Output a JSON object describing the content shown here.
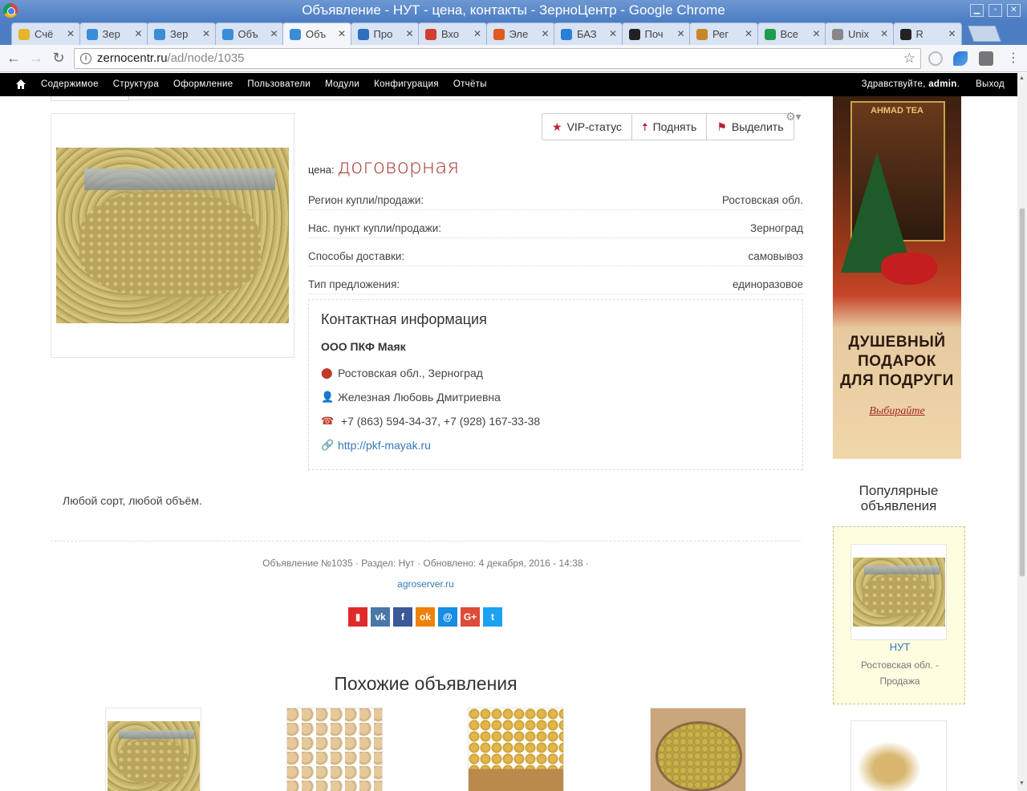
{
  "window": {
    "title": "Объявление - НУТ - цена, контакты - ЗерноЦентр - Google Chrome"
  },
  "tabs": [
    {
      "label": "Счё",
      "color": "#e8b52a"
    },
    {
      "label": "Зер",
      "color": "#3a8ed8"
    },
    {
      "label": "Зер",
      "color": "#3a8ed8"
    },
    {
      "label": "Объ",
      "color": "#3a8ed8"
    },
    {
      "label": "Объ",
      "color": "#3a8ed8"
    },
    {
      "label": "Про",
      "color": "#2f6fbf"
    },
    {
      "label": "Вхо",
      "color": "#d23f31"
    },
    {
      "label": "Эле",
      "color": "#e05a1e"
    },
    {
      "label": "БАЗ",
      "color": "#2b7fd6"
    },
    {
      "label": "Поч",
      "color": "#222222"
    },
    {
      "label": "Рег",
      "color": "#c8862a"
    },
    {
      "label": "Все",
      "color": "#1e9e4a"
    },
    {
      "label": "Unix",
      "color": "#888888"
    },
    {
      "label": "R",
      "color": "#222222"
    }
  ],
  "address": {
    "host": "zernocentr.ru",
    "path": "/ad/node/1035"
  },
  "admin": {
    "menu": [
      "Содержимое",
      "Структура",
      "Оформление",
      "Пользователи",
      "Модули",
      "Конфигурация",
      "Отчёты"
    ],
    "greeting": "Здравствуйте,",
    "user": "admin",
    "greeting_end": ".",
    "logout": "Выход"
  },
  "actions": {
    "vip": "VIP-статус",
    "raise": "Поднять",
    "highlight": "Выделить"
  },
  "price": {
    "label": "цена:",
    "value": "договорная"
  },
  "fields": [
    {
      "label": "Регион купли/продажи:",
      "value": "Ростовская обл."
    },
    {
      "label": "Нас. пункт купли/продажи:",
      "value": "Зерноград"
    },
    {
      "label": "Способы доставки:",
      "value": "самовывоз"
    },
    {
      "label": "Тип предложения:",
      "value": "единоразовое"
    }
  ],
  "contact": {
    "heading": "Контактная информация",
    "org": "ООО ПКФ Маяк",
    "location": "Ростовская обл., Зерноград",
    "person": "Железная Любовь Дмитриевна",
    "phone": "+7 (863) 594-34-37, +7 (928) 167-33-38",
    "website": "http://pkf-mayak.ru"
  },
  "description": "Любой сорт, любой объём.",
  "meta": {
    "info": "Объявление №1035 · Раздел: Нут · Обновлено: 4 декабря, 2016 - 14:38 ·",
    "source": "agroserver.ru"
  },
  "share": [
    {
      "name": "bookmark",
      "glyph": "▮",
      "color": "#e02a2a"
    },
    {
      "name": "vk",
      "glyph": "vk",
      "color": "#4a76a8"
    },
    {
      "name": "facebook",
      "glyph": "f",
      "color": "#3b5998"
    },
    {
      "name": "odnoklassniki",
      "glyph": "ok",
      "color": "#ee8208"
    },
    {
      "name": "moimir",
      "glyph": "@",
      "color": "#168de2"
    },
    {
      "name": "googleplus",
      "glyph": "G+",
      "color": "#dd4b39"
    },
    {
      "name": "twitter",
      "glyph": "t",
      "color": "#1da1f2"
    }
  ],
  "similar": {
    "heading": "Похожие объявления"
  },
  "ad": {
    "brand": "AHMAD TEA",
    "line1": "ДУШЕВНЫЙ",
    "line2": "ПОДАРОК",
    "line3": "ДЛЯ ПОДРУГИ",
    "cta": "Выбирайте"
  },
  "popular": {
    "heading": "Популярные объявления",
    "title": "НУТ",
    "region": "Ростовская обл. -",
    "type": "Продажа"
  }
}
